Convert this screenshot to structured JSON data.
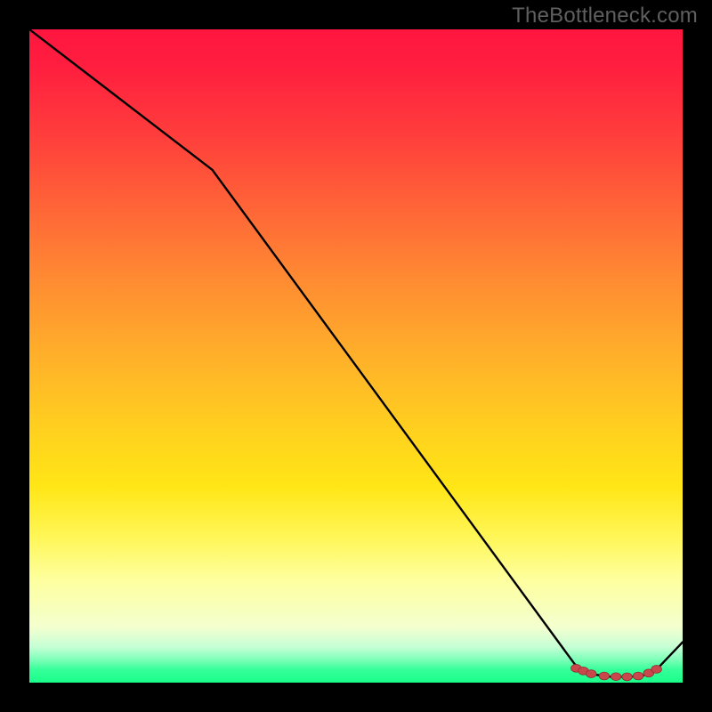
{
  "watermark": "TheBottleneck.com",
  "chart_data": {
    "type": "line",
    "title": "",
    "xlabel": "",
    "ylabel": "",
    "xlim": [
      0,
      100
    ],
    "ylim": [
      0,
      100
    ],
    "grid": false,
    "series": [
      {
        "name": "curve",
        "color": "#000000",
        "x": [
          0,
          28,
          83.5,
          86,
          89,
          92,
          94,
          96,
          100
        ],
        "y": [
          100,
          78.5,
          2.8,
          1.3,
          0.9,
          0.9,
          1.1,
          2.0,
          6.2
        ]
      }
    ],
    "markers": {
      "name": "baseline-dots",
      "color": "#c9484c",
      "stroke": "#8e3034",
      "x": [
        83.7,
        84.8,
        86.0,
        88.0,
        89.8,
        91.5,
        93.2,
        94.8,
        96.0
      ],
      "y": [
        2.2,
        1.8,
        1.35,
        1.02,
        0.92,
        0.9,
        1.02,
        1.45,
        2.05
      ]
    },
    "background_gradient": {
      "top": "#ff153f",
      "mid": "#ffe616",
      "bottom": "#1aff8b"
    }
  }
}
